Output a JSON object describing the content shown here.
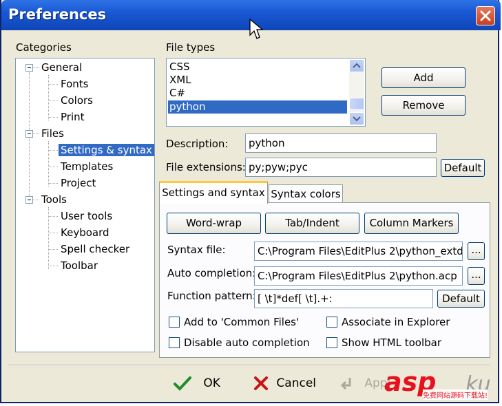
{
  "window": {
    "title": "Preferences"
  },
  "categories": {
    "label": "Categories",
    "tree": [
      {
        "label": "General",
        "level": 0
      },
      {
        "label": "Fonts",
        "level": 1
      },
      {
        "label": "Colors",
        "level": 1
      },
      {
        "label": "Print",
        "level": 1
      },
      {
        "label": "Files",
        "level": 0
      },
      {
        "label": "Settings & syntax",
        "level": 1,
        "selected": true
      },
      {
        "label": "Templates",
        "level": 1
      },
      {
        "label": "Project",
        "level": 1
      },
      {
        "label": "Tools",
        "level": 0
      },
      {
        "label": "User tools",
        "level": 1
      },
      {
        "label": "Keyboard",
        "level": 1
      },
      {
        "label": "Spell checker",
        "level": 1
      },
      {
        "label": "Toolbar",
        "level": 1
      }
    ]
  },
  "file_types": {
    "label": "File types",
    "items": [
      "CSS",
      "XML",
      "C#",
      "python"
    ],
    "selected": "python",
    "add_label": "Add",
    "remove_label": "Remove"
  },
  "description": {
    "label": "Description:",
    "value": "python"
  },
  "file_extensions": {
    "label": "File extensions:",
    "value": "py;pyw;pyc",
    "default_label": "Default"
  },
  "tabs": [
    {
      "label": "Settings and syntax",
      "active": true
    },
    {
      "label": "Syntax colors",
      "active": false
    }
  ],
  "settings": {
    "word_wrap_label": "Word-wrap",
    "tab_indent_label": "Tab/Indent",
    "column_markers_label": "Column Markers",
    "syntax_file": {
      "label": "Syntax file:",
      "value": "C:\\Program Files\\EditPlus 2\\python_extd.",
      "browse": "..."
    },
    "auto_completion": {
      "label": "Auto completion:",
      "value": "C:\\Program Files\\EditPlus 2\\python.acp",
      "browse": "..."
    },
    "function_pattern": {
      "label": "Function pattern:",
      "value": "[ \\t]*def[ \\t].+:",
      "default_label": "Default"
    },
    "checkboxes": {
      "add_common_files": {
        "label": "Add to 'Common Files'",
        "checked": false
      },
      "associate_explorer": {
        "label": "Associate in Explorer",
        "checked": false
      },
      "disable_auto_completion": {
        "label": "Disable auto completion",
        "checked": false
      },
      "show_html_toolbar": {
        "label": "Show HTML toolbar",
        "checked": false
      }
    }
  },
  "footer": {
    "ok_label": "OK",
    "cancel_label": "Cancel",
    "apply_label": "Appl"
  },
  "watermark": {
    "brand": "asp",
    "suffix": "ku",
    "sub": "免费网站源码下载站!"
  },
  "colors": {
    "title_bar": "#1a58d4",
    "selection": "#316ac5",
    "ok_check": "#1e8c28",
    "cancel_x": "#c81414",
    "watermark_red": "#e8121e"
  }
}
